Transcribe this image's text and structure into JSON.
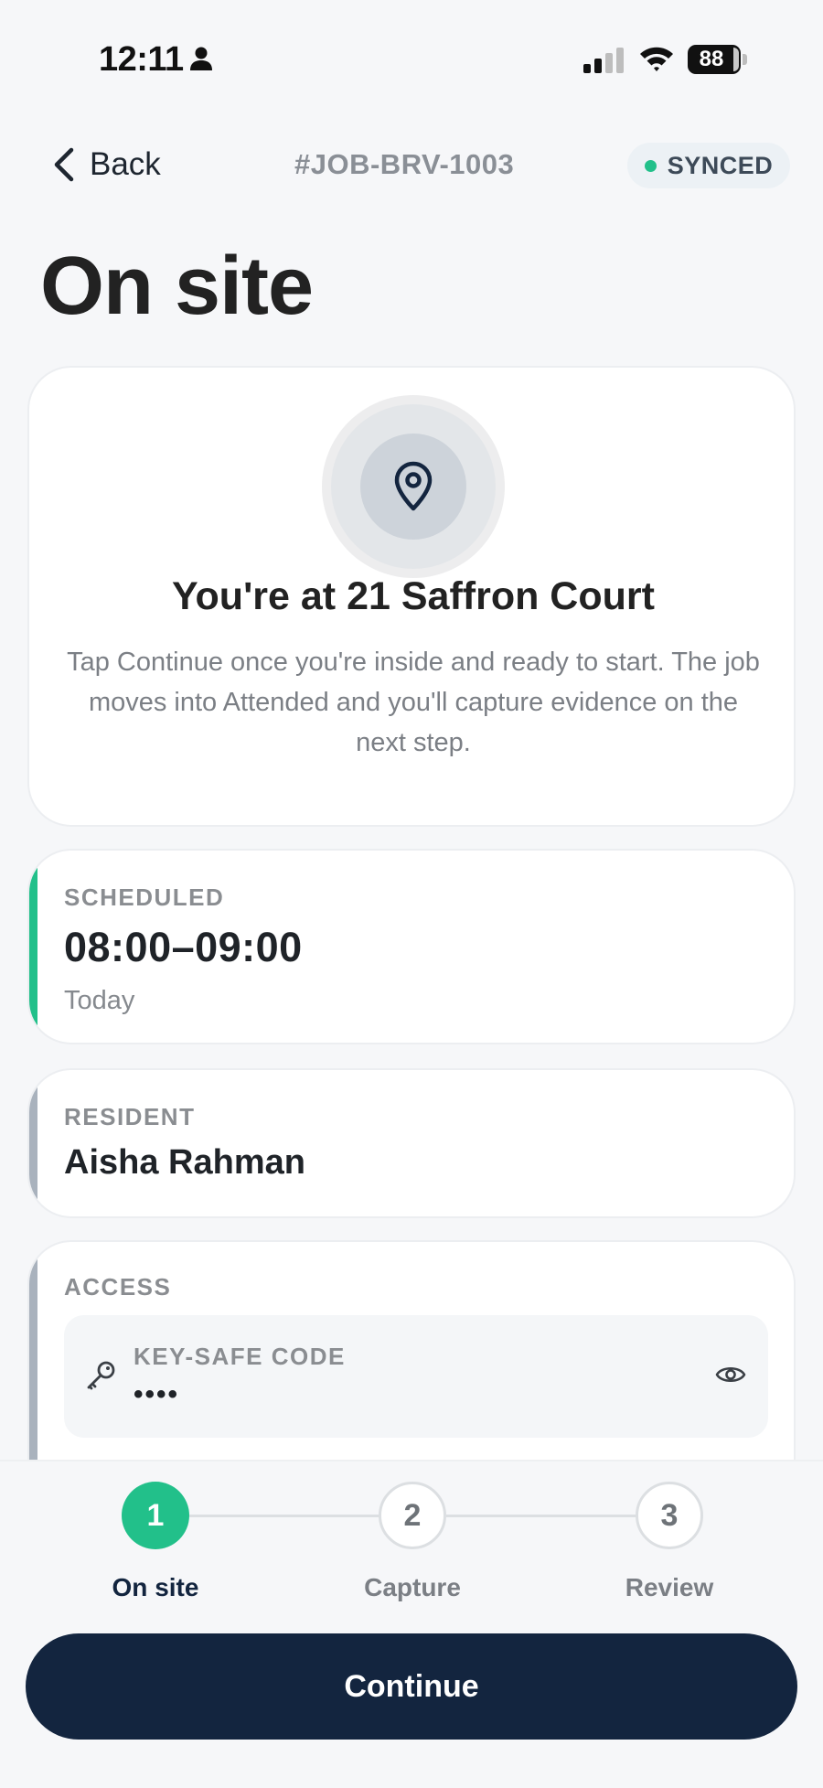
{
  "status_bar": {
    "time": "12:11",
    "battery": "88"
  },
  "header": {
    "back_label": "Back",
    "job_id": "#JOB-BRV-1003",
    "sync_status": "SYNCED"
  },
  "page_title": "On site",
  "location_card": {
    "title": "You're at 21 Saffron Court",
    "description": "Tap Continue once you're inside and ready to start. The job moves into Attended and you'll capture evidence on the next step."
  },
  "schedule": {
    "label": "SCHEDULED",
    "time_range": "08:00–09:00",
    "day": "Today"
  },
  "resident": {
    "label": "RESIDENT",
    "name": "Aisha Rahman"
  },
  "access": {
    "label": "ACCESS",
    "keysafe_label": "KEY-SAFE CODE",
    "keysafe_value": "••••"
  },
  "stepper": {
    "steps": [
      {
        "number": "1",
        "label": "On site",
        "state": "active"
      },
      {
        "number": "2",
        "label": "Capture",
        "state": "upcoming"
      },
      {
        "number": "3",
        "label": "Review",
        "state": "upcoming"
      }
    ]
  },
  "continue_label": "Continue",
  "colors": {
    "accent_green": "#22c08a",
    "primary_navy": "#13253f",
    "neutral_accent": "#a9b2bd"
  },
  "icons": {
    "back": "chevron-left-icon",
    "location": "map-pin-icon",
    "key": "key-icon",
    "reveal": "eye-icon"
  }
}
